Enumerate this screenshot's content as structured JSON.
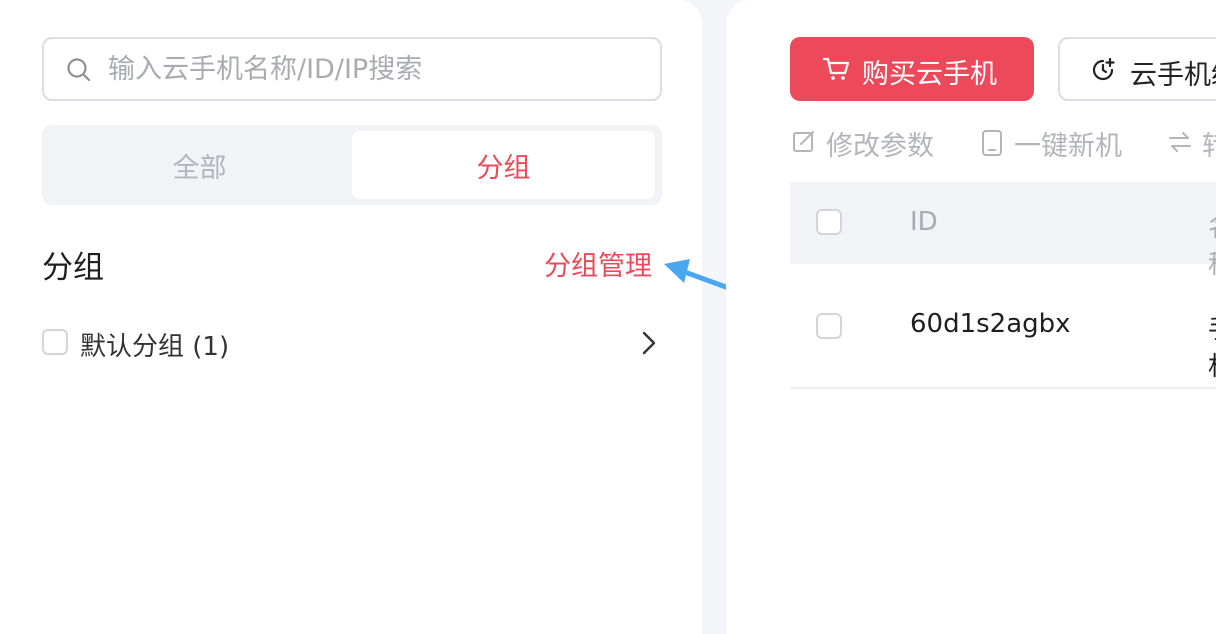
{
  "left_panel": {
    "search": {
      "placeholder": "输入云手机名称/ID/IP搜索",
      "value": ""
    },
    "segmented": {
      "all_label": "全部",
      "group_label": "分组",
      "selected": "分组"
    },
    "group_heading": "分组",
    "group_manage_label": "分组管理",
    "groups": [
      {
        "name": "默认分组 (1)",
        "checked": false
      }
    ]
  },
  "right_panel": {
    "buy_button_label": "购买云手机",
    "phone_button_label": "云手机续费",
    "toolbar": {
      "edit_params": "修改参数",
      "new_machine": "一键新机",
      "transfer": "转移"
    },
    "table": {
      "headers": [
        "ID",
        "名称"
      ],
      "rows": [
        {
          "id": "60d1s2agbx",
          "name": "手机"
        }
      ]
    }
  },
  "colors": {
    "accent": "#ec4a5b",
    "annotation_arrow": "#4aa8f0",
    "muted_text": "#b3b5bb",
    "background": "#f4f5f9"
  },
  "icons": {
    "search": "search-icon",
    "chevron": "chevron-right-icon",
    "cart": "cart-icon",
    "clock_plus": "clock-plus-icon",
    "edit": "edit-icon",
    "phone": "phone-icon",
    "transfer": "transfer-icon"
  }
}
